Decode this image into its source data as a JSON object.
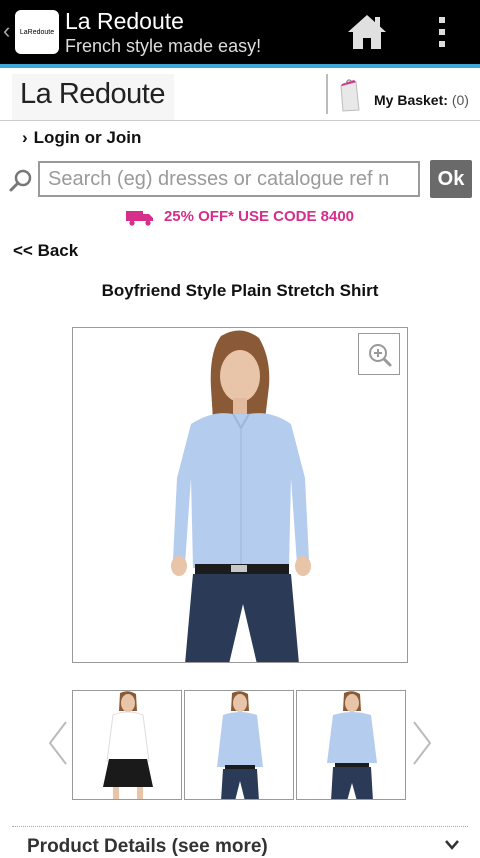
{
  "app": {
    "title": "La Redoute",
    "subtitle": "French style made easy!",
    "icon_text": "LaRedoute",
    "icons": [
      "back-chevron-icon",
      "home-icon",
      "overflow-menu-icon"
    ]
  },
  "header": {
    "logo": "La Redoute",
    "basket_label": "My Basket:",
    "basket_count": "(0)"
  },
  "account": {
    "login_label": "Login or Join"
  },
  "search": {
    "placeholder": "Search (eg) dresses or catalogue ref n",
    "submit_label": "Ok"
  },
  "promo": {
    "text": "25% OFF* USE CODE 8400",
    "color": "#d62e8a"
  },
  "nav": {
    "back_label": "<< Back"
  },
  "product": {
    "title": "Boyfriend Style Plain Stretch Shirt",
    "thumbnails": [
      {
        "shirt": "white",
        "bottom": "black skirt"
      },
      {
        "shirt": "light blue",
        "bottom": "jeans"
      },
      {
        "shirt": "light blue",
        "bottom": "jeans"
      }
    ],
    "details_label": "Product Details (see more)"
  },
  "colors": {
    "accent": "#3fa8d8",
    "appbar": "#000000",
    "ok_button": "#6a6a6a"
  }
}
